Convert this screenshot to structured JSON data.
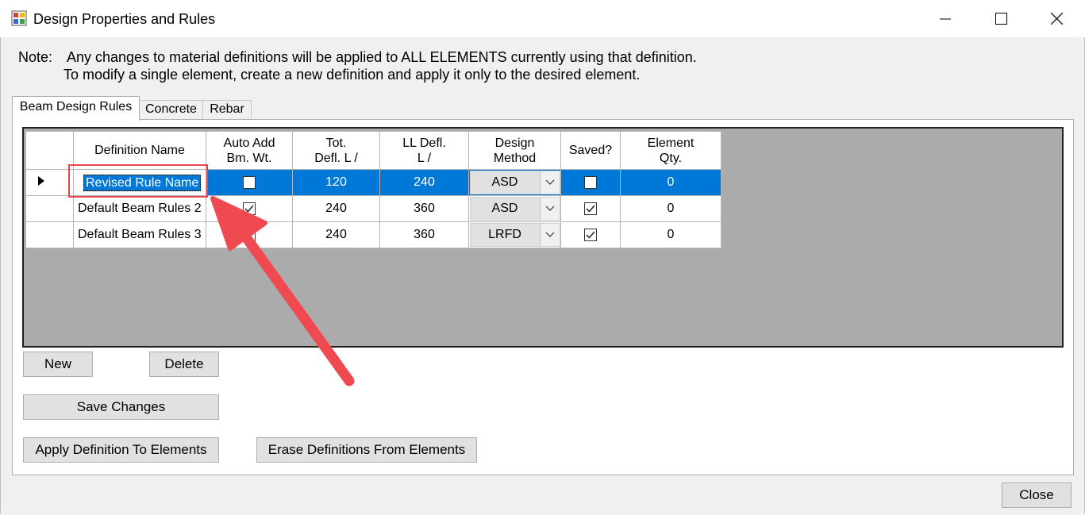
{
  "window": {
    "title": "Design Properties and Rules",
    "controls": {
      "minimize": "minimize-icon",
      "maximize": "maximize-icon",
      "close": "close-icon"
    }
  },
  "note": {
    "label": "Note:",
    "line1": "Any changes to material definitions will be applied to ALL ELEMENTS currently using that definition.",
    "line2": "To modify a single element, create a new definition and apply it only to the desired element."
  },
  "tabs": [
    {
      "label": "Beam Design Rules",
      "active": true
    },
    {
      "label": "Concrete",
      "active": false
    },
    {
      "label": "Rebar",
      "active": false
    }
  ],
  "grid": {
    "headers": {
      "name": "Definition Name",
      "auto_add_1": "Auto Add",
      "auto_add_2": "Bm. Wt.",
      "tot_1": "Tot.",
      "tot_2": "Defl. L /",
      "ll_1": "LL Defl.",
      "ll_2": "L /",
      "method_1": "Design",
      "method_2": "Method",
      "saved": "Saved?",
      "qty_1": "Element",
      "qty_2": "Qty."
    },
    "rows": [
      {
        "name": "Revised Rule Name",
        "auto_add": false,
        "tot_defl": "120",
        "ll_defl": "240",
        "method": "ASD",
        "saved": false,
        "qty": "0",
        "selected": true
      },
      {
        "name": "Default Beam Rules 2",
        "auto_add": true,
        "tot_defl": "240",
        "ll_defl": "360",
        "method": "ASD",
        "saved": true,
        "qty": "0",
        "selected": false
      },
      {
        "name": "Default Beam Rules 3",
        "auto_add": true,
        "tot_defl": "240",
        "ll_defl": "360",
        "method": "LRFD",
        "saved": true,
        "qty": "0",
        "selected": false
      }
    ]
  },
  "buttons": {
    "new": "New",
    "delete": "Delete",
    "save": "Save Changes",
    "apply": "Apply Definition To Elements",
    "erase": "Erase Definitions From Elements",
    "close": "Close"
  },
  "colors": {
    "selection": "#0078d7",
    "annotation": "#e8464f"
  }
}
